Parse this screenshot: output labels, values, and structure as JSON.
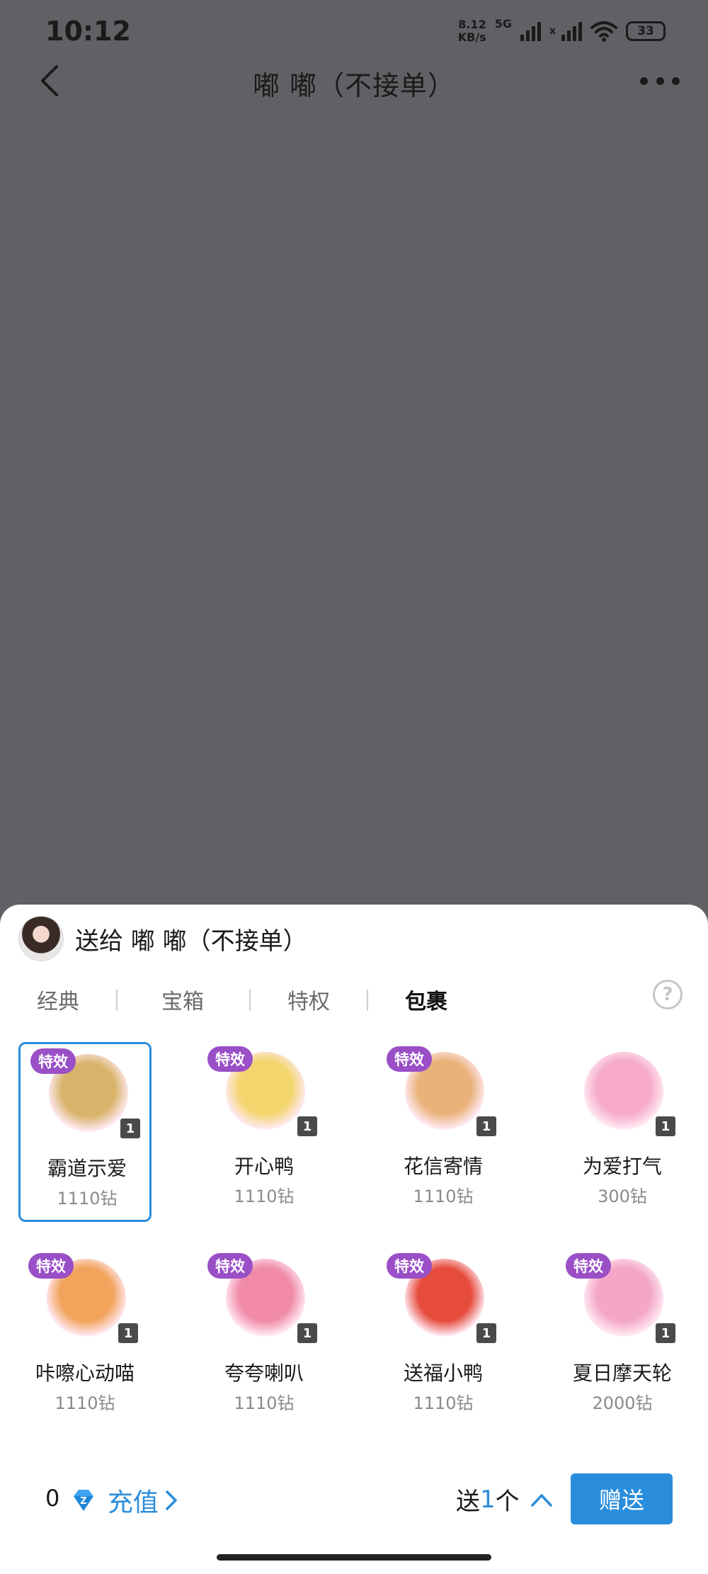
{
  "status": {
    "time": "10:12",
    "net_speed_value": "8.12",
    "net_speed_unit": "KB/s",
    "network_type": "5G",
    "battery": "33"
  },
  "header": {
    "title": "嘟 嘟（不接单）",
    "back_icon": "chevron-left-icon",
    "more_icon": "more-dots-icon"
  },
  "sheet": {
    "recipient_label": "送给 嘟 嘟（不接单）",
    "tabs": [
      {
        "label": "经典",
        "active": false
      },
      {
        "label": "宝箱",
        "active": false
      },
      {
        "label": "特权",
        "active": false
      },
      {
        "label": "包裹",
        "active": true
      }
    ],
    "help_glyph": "?",
    "gifts": [
      {
        "badge": "特效",
        "name": "霸道示爱",
        "price": "1110钻",
        "count": "1",
        "selected": true,
        "color": "#d8b46a"
      },
      {
        "badge": "特效",
        "name": "开心鸭",
        "price": "1110钻",
        "count": "1",
        "selected": false,
        "color": "#f3d56e"
      },
      {
        "badge": "特效",
        "name": "花信寄情",
        "price": "1110钻",
        "count": "1",
        "selected": false,
        "color": "#e9b27a"
      },
      {
        "badge": "",
        "name": "为爱打气",
        "price": "300钻",
        "count": "1",
        "selected": false,
        "color": "#f6a9c8"
      },
      {
        "badge": "特效",
        "name": "咔嚓心动喵",
        "price": "1110钻",
        "count": "1",
        "selected": false,
        "color": "#f2a45c"
      },
      {
        "badge": "特效",
        "name": "夸夸喇叭",
        "price": "1110钻",
        "count": "1",
        "selected": false,
        "color": "#f08aa8"
      },
      {
        "badge": "特效",
        "name": "送福小鸭",
        "price": "1110钻",
        "count": "1",
        "selected": false,
        "color": "#e64c3c"
      },
      {
        "badge": "特效",
        "name": "夏日摩天轮",
        "price": "2000钻",
        "count": "1",
        "selected": false,
        "color": "#f3a6c6"
      }
    ],
    "footer": {
      "balance": "0",
      "recharge_label": "充值",
      "send_prefix": "送",
      "send_count": "1",
      "send_suffix": "个",
      "send_button": "赠送"
    }
  },
  "colors": {
    "accent": "#2a8ddc",
    "badge": "#9a4fc7",
    "overlay": "#5f6164"
  }
}
